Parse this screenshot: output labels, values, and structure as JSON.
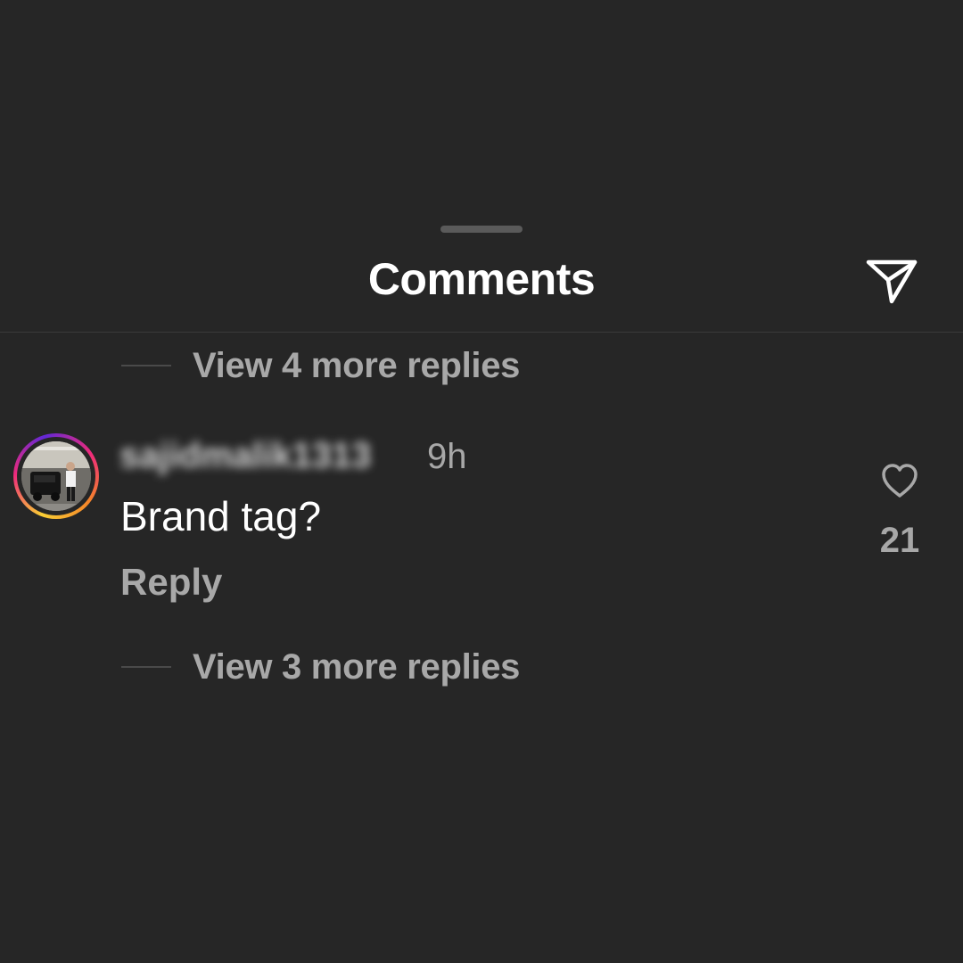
{
  "sheet": {
    "title": "Comments"
  },
  "thread": {
    "view_more_top": "View 4 more replies",
    "view_more_bottom": "View 3 more replies"
  },
  "comment": {
    "username": "sajidmalik1313",
    "timestamp": "9h",
    "text": "Brand tag?",
    "reply_label": "Reply",
    "like_count": "21"
  },
  "icons": {
    "share": "paper-plane-icon",
    "like": "heart-outline-icon"
  },
  "colors": {
    "background": "#262626",
    "primary_text": "#ffffff",
    "secondary_text": "#a8a8a8",
    "story_ring": [
      "#f9ce34",
      "#ee2a7b",
      "#6228d7"
    ]
  }
}
